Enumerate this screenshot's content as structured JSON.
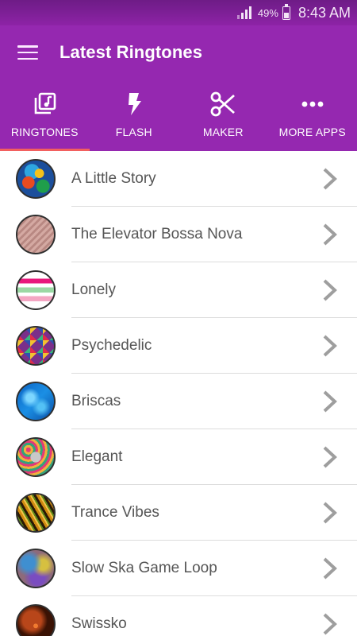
{
  "status_bar": {
    "battery_percent": "49%",
    "time": "8:43 AM"
  },
  "app_bar": {
    "title": "Latest Ringtones",
    "menu_icon": "hamburger-menu-icon"
  },
  "tabs": [
    {
      "label": "RINGTONES",
      "icon": "music-library-icon",
      "active": true
    },
    {
      "label": "FLASH",
      "icon": "flash-icon",
      "active": false
    },
    {
      "label": "MAKER",
      "icon": "scissors-icon",
      "active": false
    },
    {
      "label": "MORE APPS",
      "icon": "more-dots-icon",
      "active": false
    }
  ],
  "ringtones": [
    {
      "title": "A Little Story"
    },
    {
      "title": "The Elevator Bossa Nova"
    },
    {
      "title": "Lonely"
    },
    {
      "title": "Psychedelic"
    },
    {
      "title": "Briscas"
    },
    {
      "title": "Elegant"
    },
    {
      "title": "Trance Vibes"
    },
    {
      "title": "Slow Ska Game Loop"
    },
    {
      "title": "Swissko"
    }
  ],
  "colors": {
    "primary": "#9528b0",
    "status_bar": "#7d1f96",
    "tab_indicator": "#f2605f",
    "list_text": "#555555",
    "chevron": "#9e9e9e"
  }
}
